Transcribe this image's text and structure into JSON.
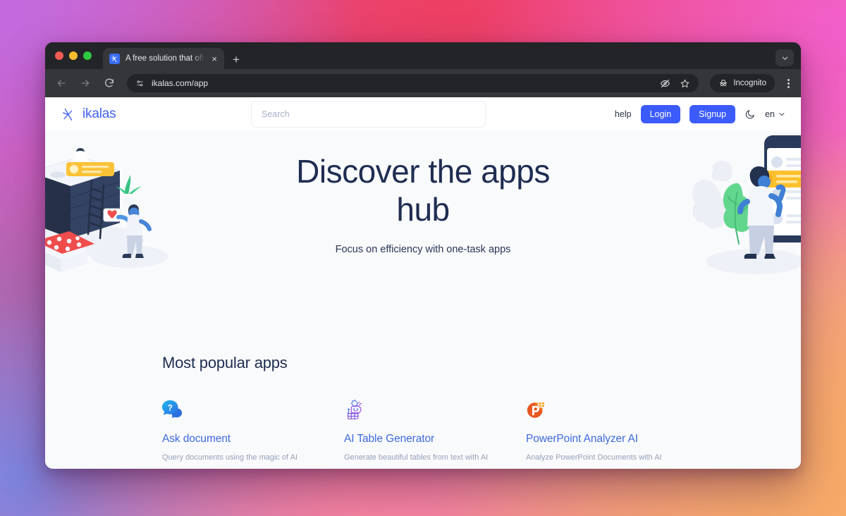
{
  "browser": {
    "tab": {
      "title": "A free solution that offers fas",
      "favicon": "ikalas-logo-icon",
      "close_label": "×"
    },
    "new_tab_label": "+",
    "nav": {
      "back": "back-arrow-icon",
      "forward": "forward-arrow-icon",
      "reload": "reload-icon"
    },
    "omnibox": {
      "url": "ikalas.com/app",
      "site_settings_icon": "tune-icon",
      "hide_icon": "eye-slash-icon",
      "bookmark_icon": "star-icon"
    },
    "incognito": {
      "label": "Incognito",
      "icon": "incognito-hat-icon"
    },
    "menu_icon": "kebab-menu-icon",
    "tabstrip_chevron": "chevron-down-icon"
  },
  "site": {
    "brand": {
      "name": "ikalas",
      "logo": "ikalas-k-logo-icon"
    },
    "search": {
      "placeholder": "Search",
      "value": ""
    },
    "nav": {
      "help": "help",
      "login": "Login",
      "signup": "Signup",
      "theme_toggle_icon": "moon-icon",
      "language": "en",
      "language_chevron": "chevron-down-icon"
    },
    "hero": {
      "title": "Discover the apps hub",
      "subtitle": "Focus on efficiency with one-task apps",
      "illustration_left": "isometric-server-ladder-person-illustration",
      "illustration_right": "person-phone-plant-illustration"
    },
    "popular": {
      "heading": "Most popular apps",
      "apps": [
        {
          "icon": "question-speech-bubble-icon",
          "title": "Ask document",
          "description": "Query documents using the magic of AI"
        },
        {
          "icon": "ai-table-robot-icon",
          "title": "AI Table Generator",
          "description": "Generate beautiful tables from text with AI"
        },
        {
          "icon": "powerpoint-icon",
          "title": "PowerPoint Analyzer AI",
          "description": "Analyze PowerPoint Documents with AI"
        }
      ]
    }
  },
  "colors": {
    "brand_blue": "#4361ee",
    "button_blue": "#3b5bfd",
    "heading_navy": "#1f2d51",
    "card_title_blue": "#3d6ae0",
    "muted_text": "#97a0b8",
    "page_bg": "#f9fafc"
  }
}
